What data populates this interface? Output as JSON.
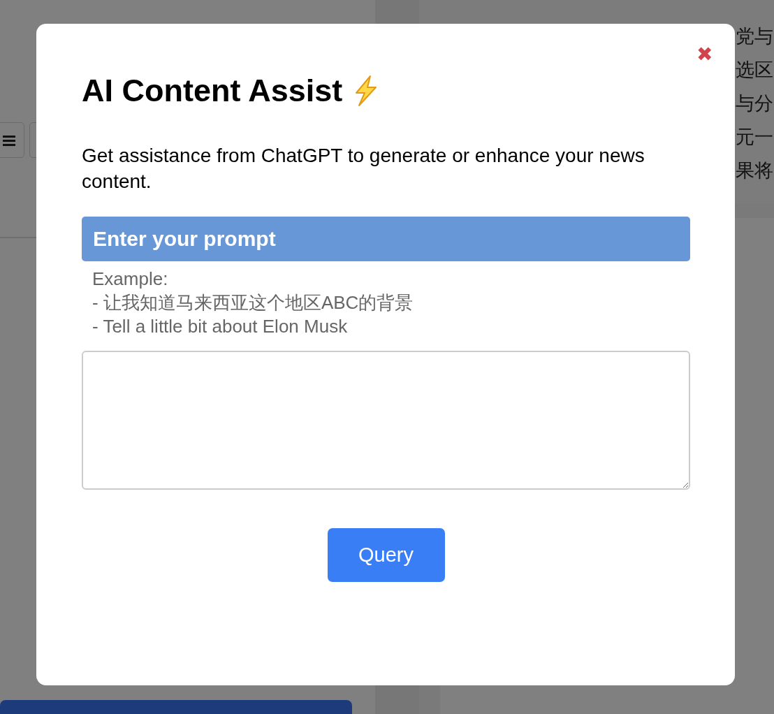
{
  "background": {
    "text_lines": [
      "党与",
      "选区",
      "与分",
      "元一",
      "果将"
    ]
  },
  "modal": {
    "title": "AI Content Assist",
    "close_label": "✖",
    "description": "Get assistance from ChatGPT to generate or enhance your news content.",
    "prompt_header": "Enter your prompt",
    "example_lines": [
      "Example:",
      "- 让我知道马来西亚这个地区ABC的背景",
      "- Tell a little bit about Elon Musk"
    ],
    "query_button": "Query"
  }
}
